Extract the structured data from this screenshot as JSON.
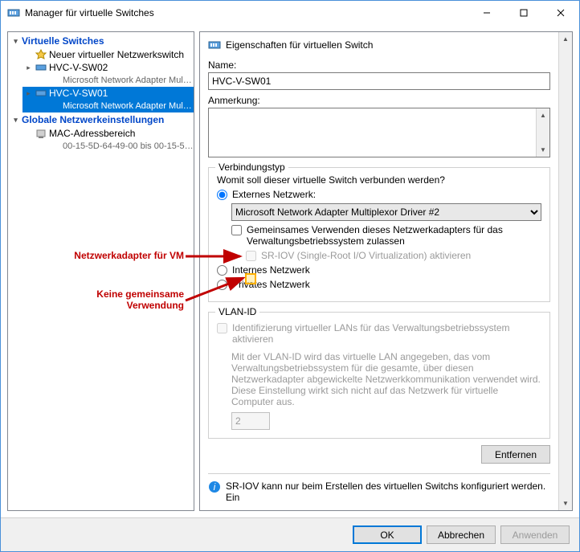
{
  "window": {
    "title": "Manager für virtuelle Switches",
    "min_tip": "Minimieren",
    "max_tip": "Maximieren",
    "close_tip": "Schließen"
  },
  "tree": {
    "section_switches": "Virtuelle Switches",
    "new_switch": "Neuer virtueller Netzwerkswitch",
    "sw02": {
      "name": "HVC-V-SW02",
      "sub": "Microsoft Network Adapter Multipl..."
    },
    "sw01": {
      "name": "HVC-V-SW01",
      "sub": "Microsoft Network Adapter Multipl..."
    },
    "section_global": "Globale Netzwerkeinstellungen",
    "mac": {
      "name": "MAC-Adressbereich",
      "sub": "00-15-5D-64-49-00 bis 00-15-5D-6..."
    }
  },
  "props": {
    "header": "Eigenschaften für virtuellen Switch",
    "name_label": "Name:",
    "name_value": "HVC-V-SW01",
    "notes_label": "Anmerkung:",
    "notes_value": "",
    "conn": {
      "legend": "Verbindungstyp",
      "prompt": "Womit soll dieser virtuelle Switch verbunden werden?",
      "external": "Externes Netzwerk:",
      "adapter": "Microsoft Network Adapter Multiplexor Driver #2",
      "share_os": "Gemeinsames Verwenden dieses Netzwerkadapters für das Verwaltungsbetriebssystem zulassen",
      "sriov": "SR-IOV (Single-Root I/O Virtualization) aktivieren",
      "internal": "Internes Netzwerk",
      "private": "Privates Netzwerk"
    },
    "vlan": {
      "legend": "VLAN-ID",
      "enable": "Identifizierung virtueller LANs für das Verwaltungsbetriebssystem aktivieren",
      "desc": "Mit der VLAN-ID wird das virtuelle LAN angegeben, das vom Verwaltungsbetriebssystem für die gesamte, über diesen Netzwerkadapter abgewickelte Netzwerkkommunikation verwendet wird. Diese Einstellung wirkt sich nicht auf das Netzwerk für virtuelle Computer aus.",
      "value": "2"
    },
    "remove_btn": "Entfernen",
    "info": "SR-IOV kann nur beim Erstellen des virtuellen Switchs konfiguriert werden. Ein"
  },
  "buttons": {
    "ok": "OK",
    "cancel": "Abbrechen",
    "apply": "Anwenden"
  },
  "annotations": {
    "adapter": "Netzwerkadapter für VM",
    "noshare1": "Keine gemeinsame",
    "noshare2": "Verwendung"
  }
}
